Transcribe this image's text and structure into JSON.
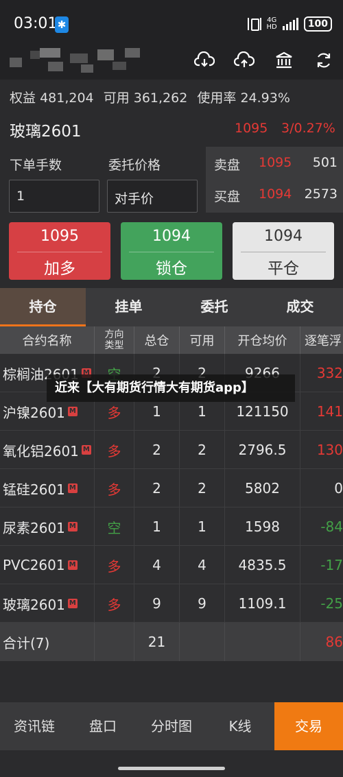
{
  "status": {
    "time": "03:01",
    "network": "4G",
    "network_sub": "HD",
    "battery": "100"
  },
  "topbar": {
    "icons": [
      "cloud-download-icon",
      "cloud-upload-icon",
      "bank-icon",
      "refresh-icon"
    ]
  },
  "account": {
    "equity_label": "权益",
    "equity": "481,204",
    "available_label": "可用",
    "available": "361,262",
    "usage_label": "使用率",
    "usage": "24.93%"
  },
  "instrument": {
    "name": "玻璃2601",
    "price": "1095",
    "change": "3/0.27%"
  },
  "order_form": {
    "qty_label": "下单手数",
    "qty_value": "1",
    "price_label": "委托价格",
    "price_value": "对手价"
  },
  "order_book": {
    "ask_label": "卖盘",
    "ask_price": "1095",
    "ask_volume": "501",
    "bid_label": "买盘",
    "bid_price": "1094",
    "bid_volume": "2573"
  },
  "actions": {
    "buy": {
      "price": "1095",
      "label": "加多"
    },
    "lock": {
      "price": "1094",
      "label": "锁仓"
    },
    "close": {
      "price": "1094",
      "label": "平仓"
    }
  },
  "tabs": [
    "持仓",
    "挂单",
    "委托",
    "成交"
  ],
  "table": {
    "headers": {
      "name": "合约名称",
      "direction_line1": "方向",
      "direction_line2": "类型",
      "total": "总仓",
      "available": "可用",
      "avg_price": "开仓均价",
      "pnl": "逐笔浮"
    },
    "rows": [
      {
        "name": "棕榈油2601",
        "direction": "空",
        "total": "2",
        "available": "2",
        "avg_price": "9266",
        "pnl": "332"
      },
      {
        "name": "沪镍2601",
        "direction": "多",
        "total": "1",
        "available": "1",
        "avg_price": "121150",
        "pnl": "141"
      },
      {
        "name": "氧化铝2601",
        "direction": "多",
        "total": "2",
        "available": "2",
        "avg_price": "2796.5",
        "pnl": "130"
      },
      {
        "name": "锰硅2601",
        "direction": "多",
        "total": "2",
        "available": "2",
        "avg_price": "5802",
        "pnl": "0"
      },
      {
        "name": "尿素2601",
        "direction": "空",
        "total": "1",
        "available": "1",
        "avg_price": "1598",
        "pnl": "-84"
      },
      {
        "name": "PVC2601",
        "direction": "多",
        "total": "4",
        "available": "4",
        "avg_price": "4835.5",
        "pnl": "-17"
      },
      {
        "name": "玻璃2601",
        "direction": "多",
        "total": "9",
        "available": "9",
        "avg_price": "1109.1",
        "pnl": "-25"
      }
    ],
    "badge": "M",
    "footer": {
      "label": "合计(7)",
      "total": "21",
      "pnl": "86"
    }
  },
  "watermark": "近来【大有期货行情大有期货app】",
  "bottom_nav": [
    "资讯链",
    "盘口",
    "分时图",
    "K线",
    "交易"
  ],
  "colors": {
    "up": "#e53935",
    "down": "#43a047",
    "accent": "#f07a12"
  }
}
